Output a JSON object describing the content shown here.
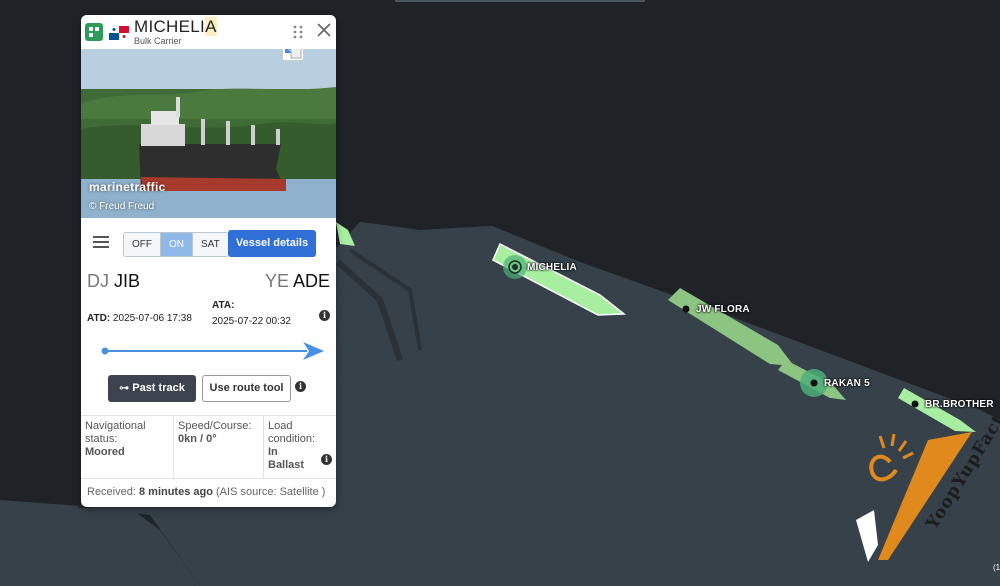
{
  "vessel": {
    "name_main": "MICHELI",
    "name_highlight": "A",
    "type": "Bulk Carrier",
    "flag_icon": "panama-flag-icon"
  },
  "photo": {
    "brand": "marinetraffic",
    "credit": "© Freud Freud"
  },
  "controls": {
    "toggle_options": [
      "OFF",
      "ON",
      "SAT"
    ],
    "toggle_selected": "ON",
    "details_button": "Vessel details"
  },
  "route": {
    "from_country": "DJ",
    "from_port": "JIB",
    "to_country": "YE",
    "to_port": "ADE",
    "atd_label": "ATD:",
    "atd_value": "2025-07-06 17:38",
    "ata_label": "ATA:",
    "ata_value": "2025-07-22 00:32",
    "progress": 1.0
  },
  "actions": {
    "past_track": "Past track",
    "route_tool": "Use route tool"
  },
  "status": {
    "nav_label": "Navigational status:",
    "nav_value": "Moored",
    "speed_label": "Speed/Course:",
    "speed_value": "0kn / 0°",
    "load_label": "Load condition:",
    "load_value": "In Ballast"
  },
  "received": {
    "prefix": "Received:",
    "time": "8 minutes ago",
    "source": "(AIS source: Satellite )"
  },
  "map": {
    "vessels": [
      {
        "name": "MICHELIA",
        "color": "#a8eea0",
        "selected": true
      },
      {
        "name": "JW FLORA",
        "color": "#8cc482",
        "selected": false
      },
      {
        "name": "RAKAN 5",
        "color": "#8cc482",
        "selected": false
      },
      {
        "name": "BR.BROTHER",
        "color": "#a8eea0",
        "selected": false
      }
    ],
    "watermark": "YoopYupFact",
    "scale_stub": "(1"
  },
  "colors": {
    "sea": "#1f2327",
    "land": "#36414a",
    "accent_blue": "#2f6fd6",
    "progress_blue": "#4a90e2"
  }
}
